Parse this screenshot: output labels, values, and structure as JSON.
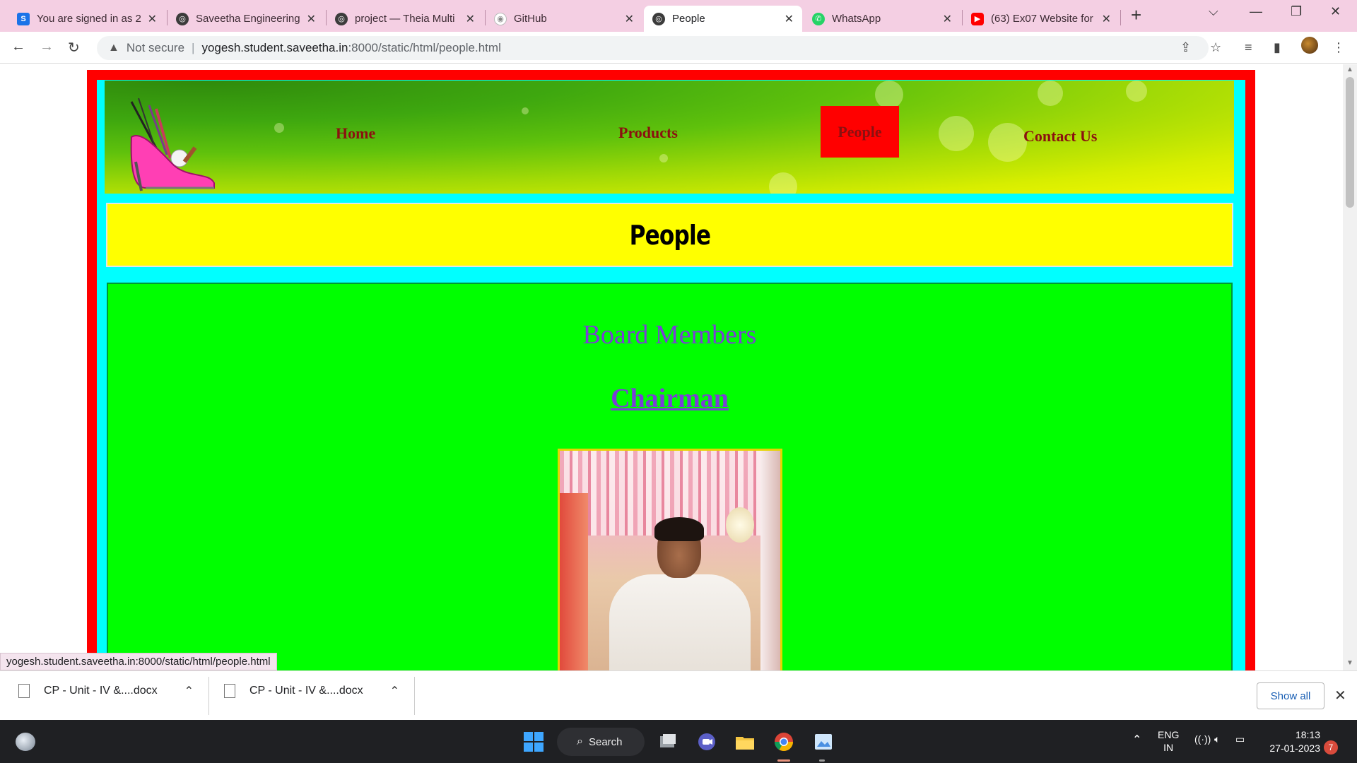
{
  "browser": {
    "tabs": [
      {
        "title": "You are signed in as 2",
        "icon": "s-icon",
        "color": "#1a73e8"
      },
      {
        "title": "Saveetha Engineering",
        "icon": "globe-icon",
        "color": "#444444"
      },
      {
        "title": "project — Theia Multi",
        "icon": "globe-icon",
        "color": "#444444"
      },
      {
        "title": "GitHub",
        "icon": "github-icon",
        "color": "#ffffff"
      },
      {
        "title": "People",
        "icon": "globe-icon",
        "color": "#444444",
        "active": true
      },
      {
        "title": "WhatsApp",
        "icon": "whatsapp-icon",
        "color": "#25d366"
      },
      {
        "title": "(63) Ex07 Website for",
        "icon": "youtube-icon",
        "color": "#ff0000"
      }
    ],
    "security_label": "Not secure",
    "url_host": "yogesh.student.saveetha.in",
    "url_rest": ":8000/static/html/people.html",
    "status_url": "yogesh.student.saveetha.in:8000/static/html/people.html"
  },
  "site": {
    "nav": {
      "home": "Home",
      "products": "Products",
      "people": "People",
      "contact": "Contact Us"
    },
    "page_title": "People",
    "section_title": "Board Members",
    "role": "Chairman",
    "colors": {
      "outer": "#ff0000",
      "frame": "#00ffff",
      "title_bg": "#ffff00",
      "content_bg": "#00ff00",
      "nav_text": "#8b1010",
      "heading_text": "#7a3fd6"
    }
  },
  "downloads": {
    "items": [
      {
        "name": "CP - Unit - IV &....docx"
      },
      {
        "name": "CP - Unit - IV &....docx"
      }
    ],
    "show_all": "Show all"
  },
  "taskbar": {
    "search": "Search",
    "lang_top": "ENG",
    "lang_bottom": "IN",
    "time": "18:13",
    "date": "27-01-2023",
    "notifications": "7"
  }
}
